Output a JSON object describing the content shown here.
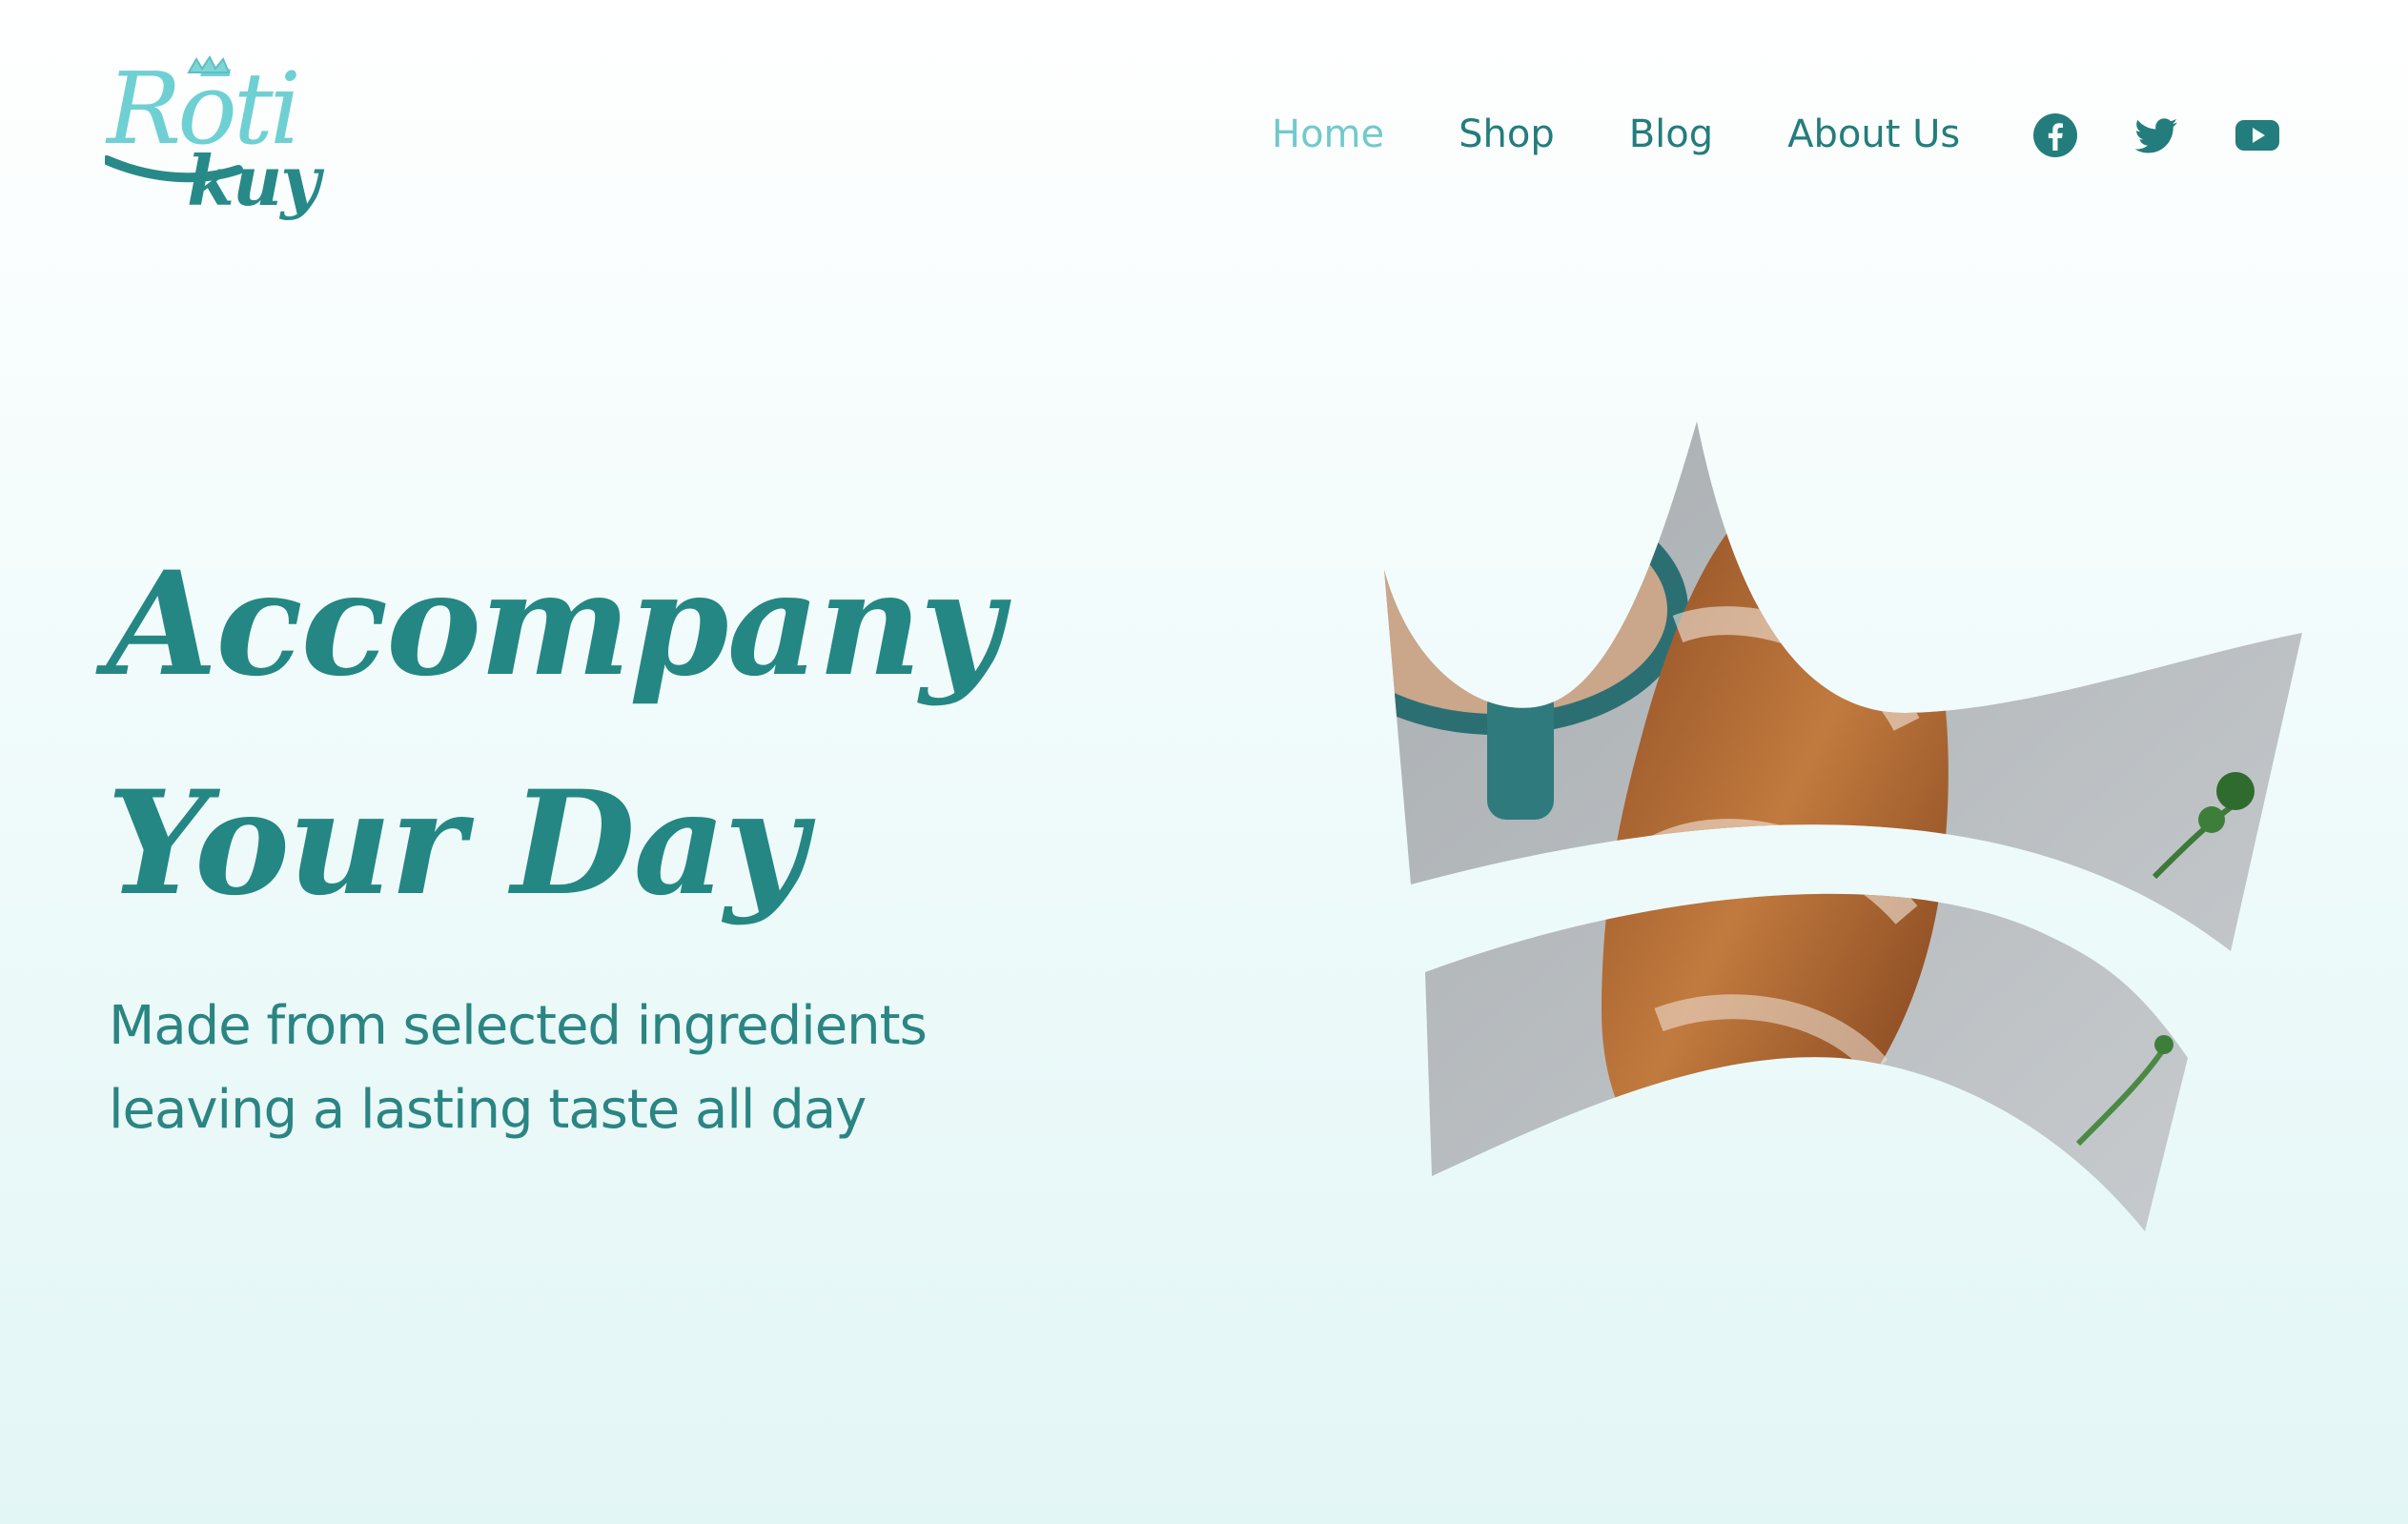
{
  "brand": {
    "logo_top": "Rōti",
    "logo_bottom": "kuy"
  },
  "nav": {
    "items": [
      {
        "label": "Home",
        "active": true
      },
      {
        "label": "Shop",
        "active": false
      },
      {
        "label": "Blog",
        "active": false
      },
      {
        "label": "About Us",
        "active": false
      }
    ]
  },
  "socials": [
    "facebook-icon",
    "twitter-icon",
    "youtube-icon"
  ],
  "hero": {
    "title_line1": "Accompany",
    "title_line2": "Your Day",
    "subtitle_line1": "Made from selected ingredients",
    "subtitle_line2": "leaving a lasting taste all day"
  },
  "colors": {
    "primary": "#248784",
    "accent": "#72c9cc",
    "background": "#effafa"
  }
}
